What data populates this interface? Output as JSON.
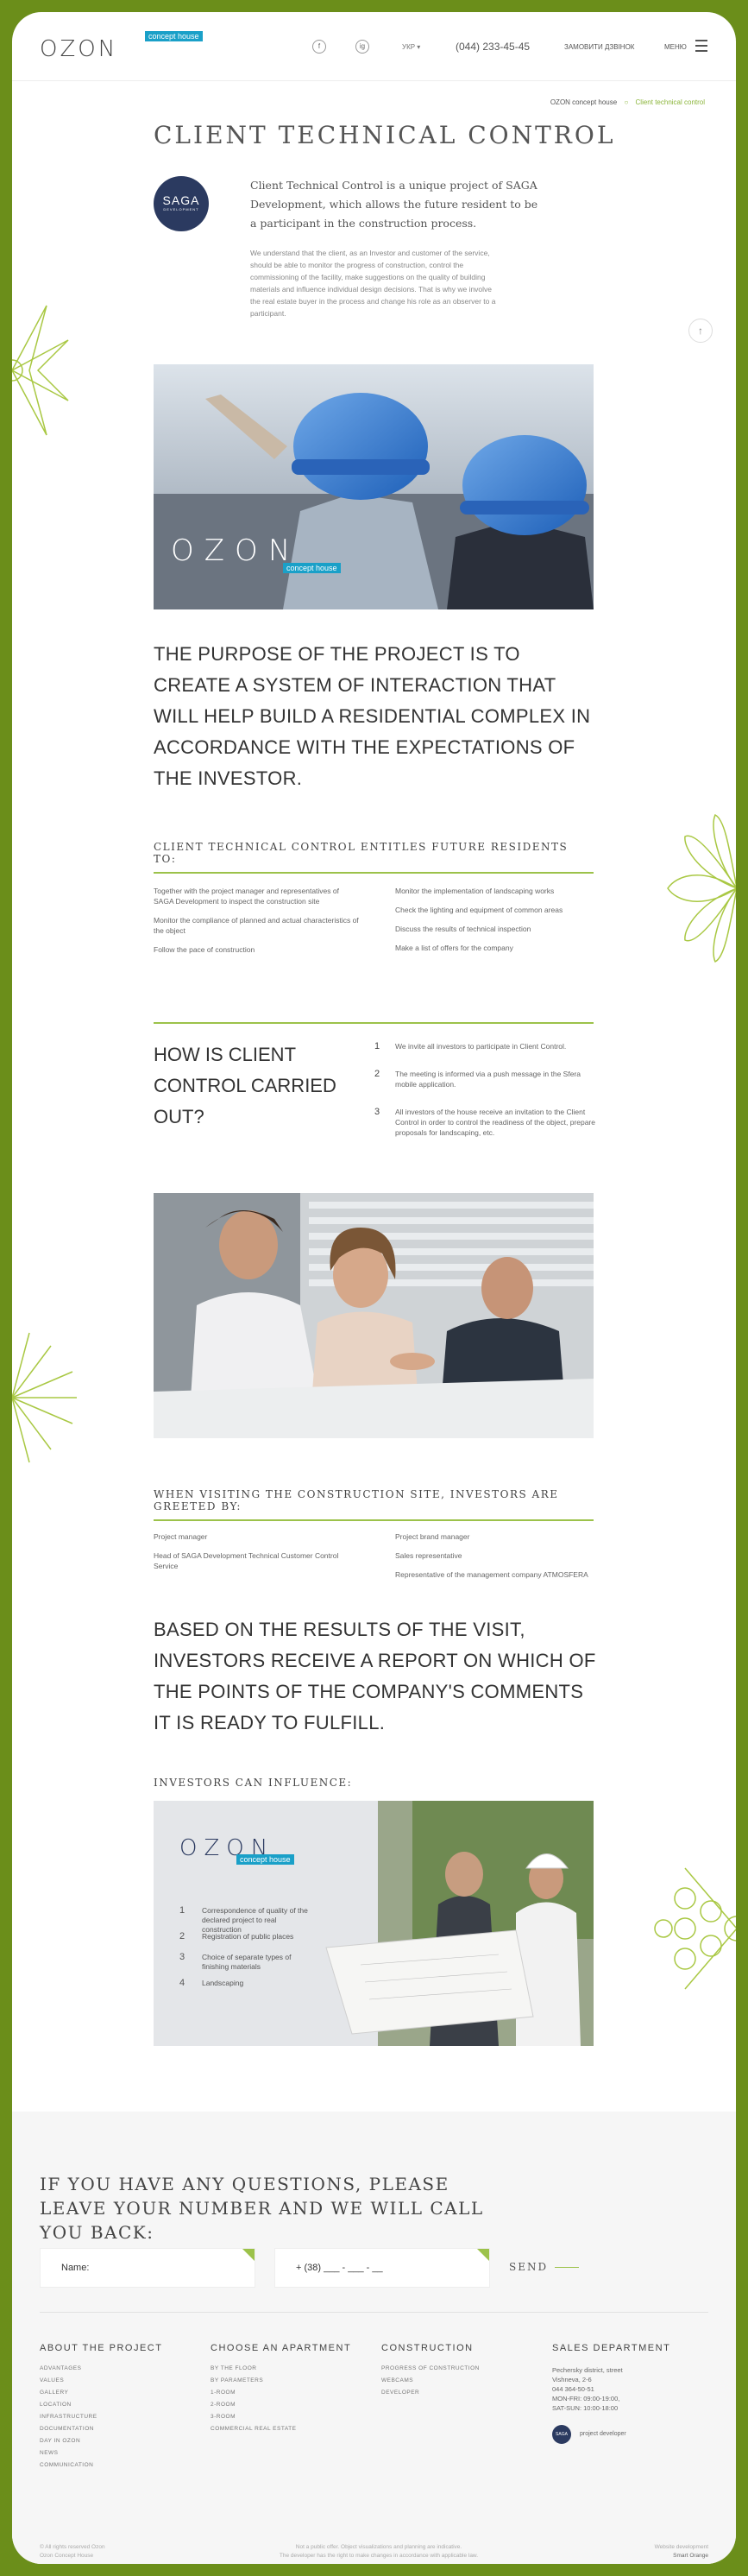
{
  "header": {
    "logo": "OZON",
    "logo_badge": "concept house",
    "social": [
      "f",
      "ig"
    ],
    "lang": "УКР ▾",
    "phone": "(044) 233-45-45",
    "callback": "ЗАМОВИТИ ДЗВІНОК",
    "menu": "МЕНЮ"
  },
  "breadcrumbs": {
    "home": "OZON concept house",
    "sep": "○",
    "current": "Client technical control"
  },
  "title": "CLIENT TECHNICAL CONTROL",
  "saga": {
    "name": "SAGA",
    "sub": "DEVELOPMENT"
  },
  "lead": "Client Technical Control is a unique project of SAGA Development, which allows the future resident to be a participant in the construction process.",
  "intro": "We understand that the client, as an Investor and customer of the service, should be able to monitor the progress of construction, control the commissioning of the facility, make suggestions on the quality of building materials and influence individual design decisions. That is why we involve the real estate buyer in the process and change his role as an observer to a participant.",
  "up_arrow": "↑",
  "photo1_logo": {
    "text": "OZON",
    "badge": "concept house"
  },
  "purpose": "THE PURPOSE OF THE PROJECT IS TO CREATE A SYSTEM OF INTERACTION THAT WILL HELP BUILD A RESIDENTIAL COMPLEX IN ACCORDANCE WITH THE EXPECTATIONS OF THE INVESTOR.",
  "entitles": {
    "heading": "CLIENT TECHNICAL CONTROL ENTITLES FUTURE RESIDENTS TO:",
    "left": [
      "Together with the project manager and representatives of SAGA Development to inspect the construction site",
      "Monitor the compliance of planned and actual characteristics of the object",
      "Follow the pace of construction"
    ],
    "right": [
      "Monitor the implementation of landscaping works",
      "Check the lighting and equipment of common areas",
      "Discuss the results of technical inspection",
      "Make a list of offers for the company"
    ]
  },
  "how": {
    "heading": "HOW IS CLIENT CONTROL CARRIED OUT?",
    "steps": [
      {
        "n": "1",
        "text": "We invite all investors to participate in Client Control."
      },
      {
        "n": "2",
        "text": "The meeting is informed via a push message in the Sfera mobile application."
      },
      {
        "n": "3",
        "text": "All investors of the house receive an invitation to the Client Control in order to control the readiness of the object, prepare proposals for landscaping, etc."
      }
    ]
  },
  "greeted": {
    "heading": "WHEN VISITING THE CONSTRUCTION SITE, INVESTORS ARE GREETED BY:",
    "left": [
      "Project manager",
      "Head of SAGA Development Technical Customer Control Service"
    ],
    "right": [
      "Project brand manager",
      "Sales representative",
      "Representative of the management company ATMOSFERA"
    ]
  },
  "results": "BASED ON THE RESULTS OF THE VISIT, INVESTORS RECEIVE A REPORT ON WHICH OF THE POINTS OF THE COMPANY'S COMMENTS IT IS READY TO FULFILL.",
  "influence": {
    "heading": "INVESTORS CAN INFLUENCE:",
    "logo": "OZON",
    "badge": "concept house",
    "items": [
      {
        "n": "1",
        "text": "Correspondence of quality of the declared project to real construction"
      },
      {
        "n": "2",
        "text": "Registration of public places"
      },
      {
        "n": "3",
        "text": "Choice of separate types of finishing materials"
      },
      {
        "n": "4",
        "text": "Landscaping"
      }
    ]
  },
  "contact": {
    "heading": "IF YOU HAVE ANY QUESTIONS, PLEASE LEAVE YOUR NUMBER AND WE WILL CALL YOU BACK:",
    "name_label": "Name:",
    "phone_value": "+ (38) ___ - ___ - __",
    "send": "SEND"
  },
  "footer": {
    "about": {
      "title": "ABOUT THE PROJECT",
      "links": [
        "ADVANTAGES",
        "VALUES",
        "GALLERY",
        "LOCATION",
        "INFRASTRUCTURE",
        "DOCUMENTATION",
        "DAY IN OZON",
        "NEWS",
        "COMMUNICATION"
      ]
    },
    "apartment": {
      "title": "CHOOSE AN APARTMENT",
      "links": [
        "BY THE FLOOR",
        "BY PARAMETERS",
        "1-ROOM",
        "2-ROOM",
        "3-ROOM",
        "COMMERCIAL REAL ESTATE"
      ]
    },
    "construction": {
      "title": "CONSTRUCTION",
      "links": [
        "PROGRESS OF CONSTRUCTION",
        "WEBCAMS",
        "DEVELOPER"
      ]
    },
    "sales": {
      "title": "SALES DEPARTMENT",
      "address": "Pechersky district, street Vishneva, 2-6",
      "phone": "044 364-50-51",
      "hours1": "MON-FRI: 09:00-19:00,",
      "hours2": "SAT-SUN: 10:00-18:00",
      "dev_label": "project developer",
      "dev_logo": "SAGA"
    },
    "copyright1": "© All rights reserved Ozon",
    "copyright2": "Ozon Concept House",
    "disclaimer1": "Not a public offer. Object visualizations and planning are indicative.",
    "disclaimer2": "The developer has the right to make changes in accordance with applicable law.",
    "made1": "Website development",
    "made2": "Smart Orange"
  },
  "colors": {
    "frame": "#6b8e1a",
    "accent": "#9cc24a",
    "badge": "#1aa0c8",
    "saga": "#2b3a60"
  }
}
